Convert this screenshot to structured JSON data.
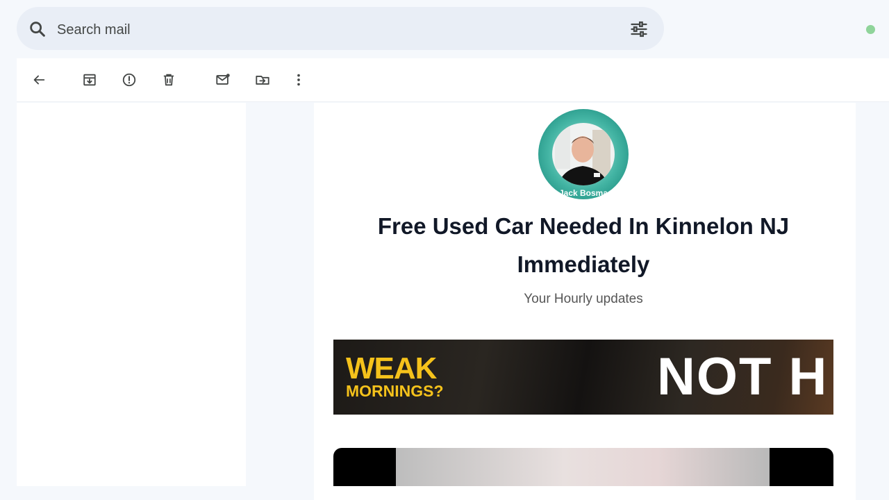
{
  "search": {
    "placeholder": "Search mail"
  },
  "toolbar": {
    "icons": [
      "back-arrow-icon",
      "archive-icon",
      "report-spam-icon",
      "delete-icon",
      "mark-unread-icon",
      "move-to-icon",
      "more-options-icon"
    ]
  },
  "email": {
    "avatar_name": "Jack Bosma",
    "title": "Free Used Car Needed In Kinnelon NJ Immediately",
    "subtitle": "Your Hourly updates",
    "banner": {
      "line1": "WEAK",
      "line2": "MORNINGS?",
      "right_text": "NOT H"
    }
  },
  "colors": {
    "accent_status": "#8fd49a",
    "banner_yellow": "#f5c21b",
    "avatar_teal": "#1a9383"
  }
}
